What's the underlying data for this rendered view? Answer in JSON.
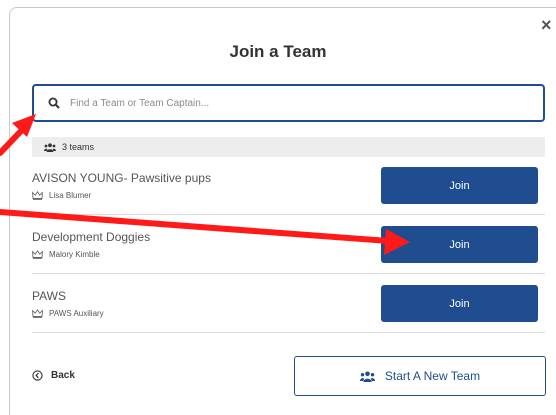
{
  "modal": {
    "title": "Join a Team",
    "close_glyph": "×"
  },
  "search": {
    "placeholder": "Find a Team or Team Captain...",
    "value": ""
  },
  "team_count": "3 teams",
  "teams": [
    {
      "name": "AVISON YOUNG- Pawsitive pups",
      "captain": "Lisa Blumer",
      "join_label": "Join"
    },
    {
      "name": "Development Doggies",
      "captain": "Malory Kimble",
      "join_label": "Join"
    },
    {
      "name": "PAWS",
      "captain": "PAWS Auxiliary",
      "join_label": "Join"
    }
  ],
  "footer": {
    "back_label": "Back",
    "start_label": "Start A New Team"
  },
  "icons": {
    "close": "close-icon",
    "search": "search-icon",
    "team_count": "users-icon",
    "captain": "crown-icon",
    "back": "back-circle-icon",
    "start": "users-icon"
  },
  "colors": {
    "primary": "#1f4d8f",
    "annotation": "#ff0000",
    "count_bar": "#ededed"
  }
}
